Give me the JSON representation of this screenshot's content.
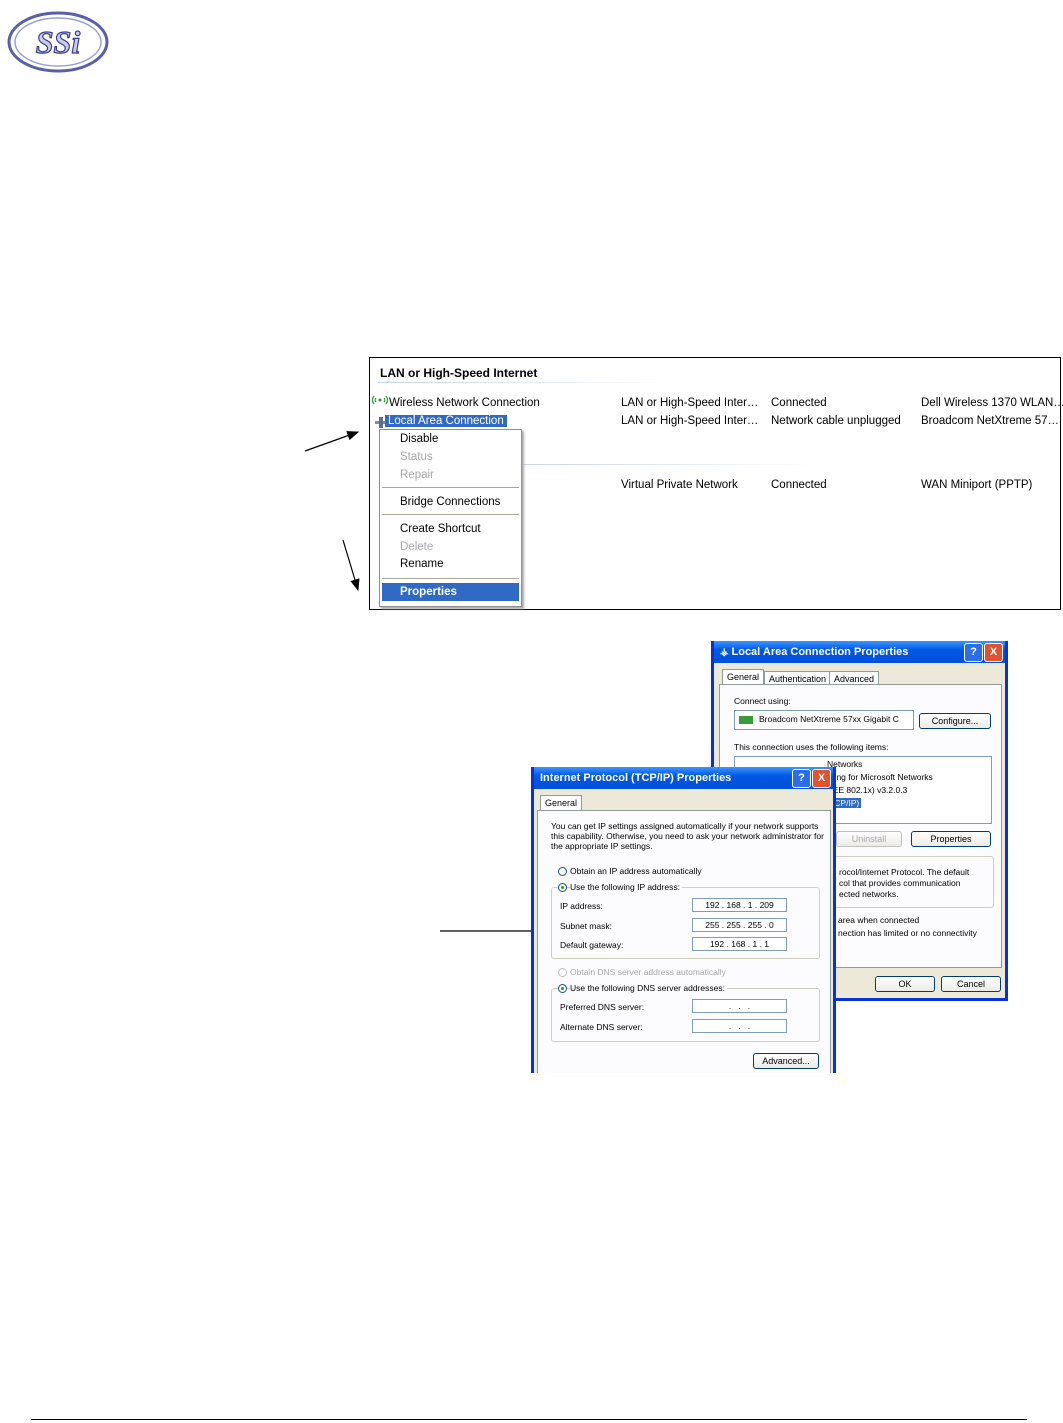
{
  "logo": {
    "text": "SSi"
  },
  "network_panel": {
    "group_header": "LAN or High-Speed Internet",
    "connections": [
      {
        "name": "Wireless Network Connection",
        "type": "LAN or High-Speed Inter…",
        "status": "Connected",
        "device": "Dell Wireless 1370 WLAN…"
      },
      {
        "name": "Local Area Connection",
        "type": "LAN or High-Speed Inter…",
        "status": "Network cable unplugged",
        "device": "Broadcom NetXtreme 57…"
      },
      {
        "name": "",
        "type": "Virtual Private Network",
        "status": "Connected",
        "device": "WAN Miniport (PPTP)"
      }
    ],
    "context_menu": {
      "items": [
        "Disable",
        "Status",
        "Repair",
        "Bridge Connections",
        "Create Shortcut",
        "Delete",
        "Rename",
        "Properties"
      ]
    }
  },
  "lac_props": {
    "title": "Local Area Connection Properties",
    "help_label": "?",
    "close_label": "X",
    "tabs": [
      "General",
      "Authentication",
      "Advanced"
    ],
    "connect_using_label": "Connect using:",
    "adapter_name": "Broadcom NetXtreme 57xx Gigabit C",
    "configure_button": "Configure...",
    "items_label": "This connection uses the following items:",
    "items_partial": [
      "Networks",
      "aring for Microsoft Networks",
      "EEE 802.1x) v3.2.0.3",
      "TCP/IP)"
    ],
    "uninstall_button": "Uninstall",
    "properties_button": "Properties",
    "description_partial": [
      "rocol/Internet Protocol. The default",
      "col that provides communication",
      "ected networks."
    ],
    "notify_partial": [
      "area when connected",
      "nection has limited or no connectivity"
    ],
    "ok_button": "OK",
    "cancel_button": "Cancel"
  },
  "tcpip_props": {
    "title": "Internet Protocol (TCP/IP) Properties",
    "help_label": "?",
    "close_label": "X",
    "tab": "General",
    "intro_lines": [
      "You can get IP settings assigned automatically if your network supports",
      "this capability. Otherwise, you need to ask your network administrator for",
      "the appropriate IP settings."
    ],
    "obtain_ip_auto": "Obtain an IP address automatically",
    "use_following_ip": "Use the following IP address:",
    "ip_address_label": "IP address:",
    "ip_address_value": "192 . 168 .  1  . 209",
    "subnet_label": "Subnet mask:",
    "subnet_value": "255 . 255 . 255 .  0",
    "gateway_label": "Default gateway:",
    "gateway_value": "192 . 168 .  1  .  1",
    "obtain_dns_auto": "Obtain DNS server address automatically",
    "use_following_dns": "Use the following DNS server addresses:",
    "preferred_dns_label": "Preferred DNS server:",
    "preferred_dns_value": " .   .   . ",
    "alternate_dns_label": "Alternate DNS server:",
    "alternate_dns_value": " .   .   . ",
    "advanced_button": "Advanced..."
  }
}
